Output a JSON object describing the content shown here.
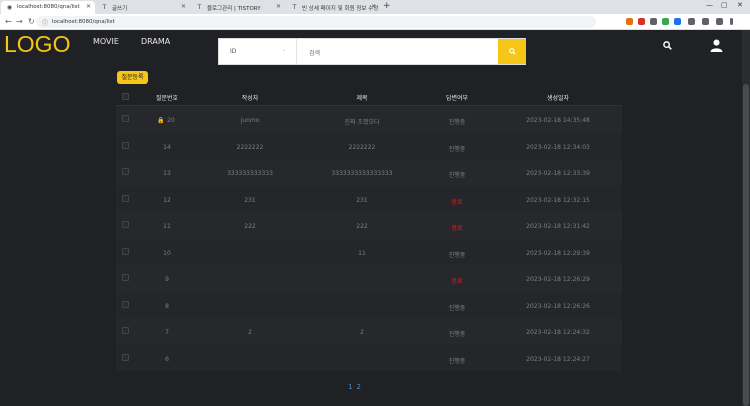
{
  "browser": {
    "tabs": [
      {
        "title": "localhost:8080/qna/list",
        "active": true
      },
      {
        "title": "글쓰기",
        "active": false
      },
      {
        "title": "블로그관리 | TISTORY",
        "active": false
      },
      {
        "title": "빈 상세 페이지 및 회원 정보 수정",
        "active": false
      }
    ],
    "url": "localhost:8080/qna/list",
    "new_tab_label": "+"
  },
  "header": {
    "logo": "LOGO",
    "menu": [
      "MOVIE",
      "DRAMA"
    ],
    "search": {
      "select_value": "ID",
      "placeholder": "검색",
      "button_icon": "search-icon"
    },
    "icons": [
      "search-icon",
      "user-icon"
    ]
  },
  "register_button": "질문등록",
  "table": {
    "columns": [
      "질문번호",
      "작성자",
      "제목",
      "답변여부",
      "생성일자"
    ],
    "rows": [
      {
        "no": "20",
        "writer": "junmo",
        "title": "진짜 조졌모다",
        "status": "진행중",
        "done": false,
        "created": "2023-02-18 14:35:48",
        "locked": true
      },
      {
        "no": "14",
        "writer": "2222222",
        "title": "2222222",
        "status": "진행중",
        "done": false,
        "created": "2023-02-18 12:34:03",
        "locked": false
      },
      {
        "no": "13",
        "writer": "333333333333",
        "title": "3333333333333333",
        "status": "진행중",
        "done": false,
        "created": "2023-02-18 12:33:39",
        "locked": false
      },
      {
        "no": "12",
        "writer": "231",
        "title": "231",
        "status": "완료",
        "done": true,
        "created": "2023-02-18 12:32:15",
        "locked": false
      },
      {
        "no": "11",
        "writer": "222",
        "title": "222",
        "status": "완료",
        "done": true,
        "created": "2023-02-18 12:31:42",
        "locked": false
      },
      {
        "no": "10",
        "writer": "",
        "title": "11",
        "status": "진행중",
        "done": false,
        "created": "2023-02-18 12:29:39",
        "locked": false
      },
      {
        "no": "9",
        "writer": "",
        "title": "",
        "status": "완료",
        "done": true,
        "created": "2023-02-18 12:26:29",
        "locked": false
      },
      {
        "no": "8",
        "writer": "",
        "title": "",
        "status": "진행중",
        "done": false,
        "created": "2023-02-18 12:26:26",
        "locked": false
      },
      {
        "no": "7",
        "writer": "2",
        "title": "2",
        "status": "진행중",
        "done": false,
        "created": "2023-02-18 12:24:32",
        "locked": false
      },
      {
        "no": "6",
        "writer": "",
        "title": "",
        "status": "진행중",
        "done": false,
        "created": "2023-02-18 12:24:27",
        "locked": false
      }
    ]
  },
  "pagination": [
    "1",
    "2"
  ],
  "colors": {
    "accent": "#f5c518",
    "done": "#e31c1c",
    "background": "#202124"
  }
}
